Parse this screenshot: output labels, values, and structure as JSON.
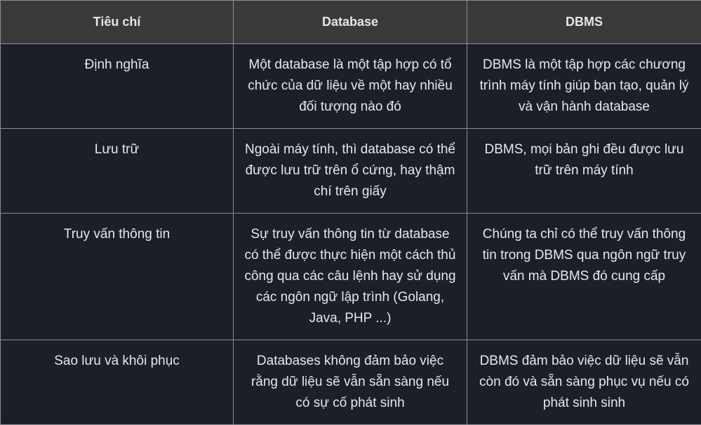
{
  "table": {
    "headers": [
      "Tiêu chí",
      "Database",
      "DBMS"
    ],
    "rows": [
      {
        "criterion": "Định nghĩa",
        "database": "Một database là một tập hợp có tổ chức của dữ liệu về một hay nhiều đối tượng nào đó",
        "dbms": "DBMS là một tập hợp các chương trình máy tính giúp bạn tạo, quản lý và vận hành database"
      },
      {
        "criterion": "Lưu trữ",
        "database": "Ngoài máy tính, thì database có thể được lưu trữ trên ổ cứng, hay thậm chí trên giấy",
        "dbms": "DBMS, mọi bản ghi đều được lưu trữ trên máy tính"
      },
      {
        "criterion": "Truy vấn thông tin",
        "database": "Sự truy vấn thông tin từ database có thể được thực hiện một cách thủ công qua các câu lệnh hay sử dụng các ngôn ngữ lập trình (Golang, Java, PHP ...)",
        "dbms": "Chúng ta chỉ có thể truy vấn thông tin trong DBMS qua ngôn ngữ truy vấn mà DBMS đó cung cấp"
      },
      {
        "criterion": "Sao lưu và khôi phục",
        "database": "Databases không đảm bảo việc rằng dữ liệu sẽ vẫn sẵn sàng nếu có sự cố phát sinh",
        "dbms": "DBMS đảm bảo việc dữ liệu sẽ vẫn còn đó và sẵn sàng phục vụ nếu có phát sinh sinh"
      }
    ]
  }
}
